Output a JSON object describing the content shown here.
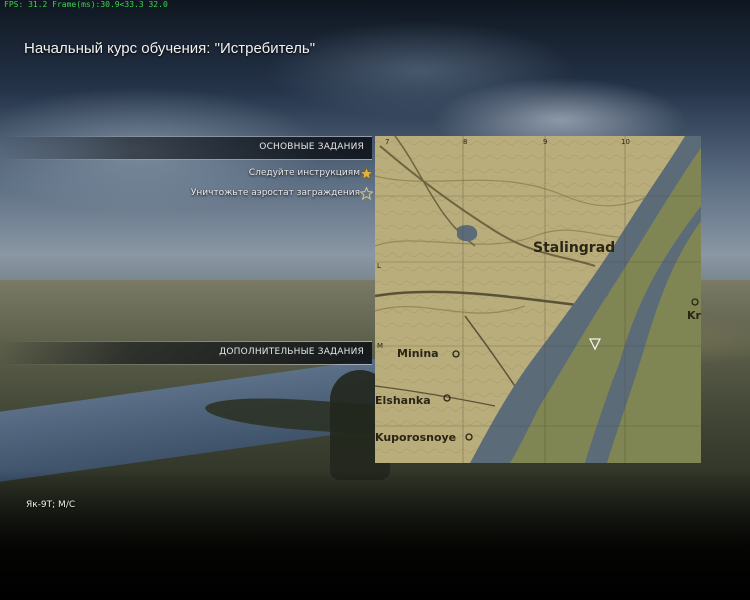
{
  "debug": {
    "fps_text": "FPS: 31.2 Frame(ms):30.9<33.3 32.0"
  },
  "mission": {
    "title": "Начальный курс обучения: \"Истребитель\""
  },
  "objectives": {
    "main_header": "ОСНОВНЫЕ ЗАДАНИЯ",
    "main_tasks": [
      {
        "label": "Следуйте инструкциям"
      },
      {
        "label": "Уничтожьте аэростат заграждения"
      }
    ],
    "extra_header": "ДОПОЛНИТЕЛЬНЫЕ ЗАДАНИЯ"
  },
  "map": {
    "grid_cols": [
      "7",
      "8",
      "9",
      "10"
    ],
    "grid_rows": [
      "L",
      "M"
    ],
    "places": [
      "Stalingrad",
      "Minina",
      "Elshanka",
      "Kuporosnoye",
      "Kr"
    ],
    "colors": {
      "land": "#b9ad7c",
      "water": "#5c6b78",
      "lowland": "#7f8553"
    }
  },
  "aircraft": {
    "label": "Як-9Т; М/С"
  }
}
